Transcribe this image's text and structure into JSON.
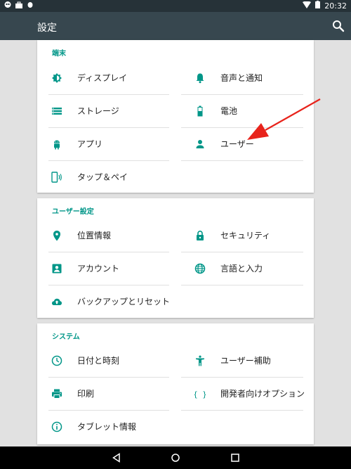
{
  "status_bar": {
    "time": "20:32"
  },
  "app_bar": {
    "title": "設定"
  },
  "sections": {
    "device": {
      "header": "端末",
      "items": {
        "display": "ディスプレイ",
        "sound": "音声と通知",
        "storage": "ストレージ",
        "battery": "電池",
        "apps": "アプリ",
        "users": "ユーザー",
        "tap_pay": "タップ＆ペイ"
      }
    },
    "personal": {
      "header": "ユーザー設定",
      "items": {
        "location": "位置情報",
        "security": "セキュリティ",
        "accounts": "アカウント",
        "language": "言語と入力",
        "backup": "バックアップとリセット"
      }
    },
    "system": {
      "header": "システム",
      "items": {
        "datetime": "日付と時刻",
        "accessibility": "ユーザー補助",
        "printing": "印刷",
        "developer": "開発者向けオプション",
        "about": "タブレット情報"
      }
    }
  },
  "colors": {
    "accent": "#009688",
    "appbar": "#37474f",
    "statusbar": "#263238",
    "annotation": "#e8231b"
  }
}
